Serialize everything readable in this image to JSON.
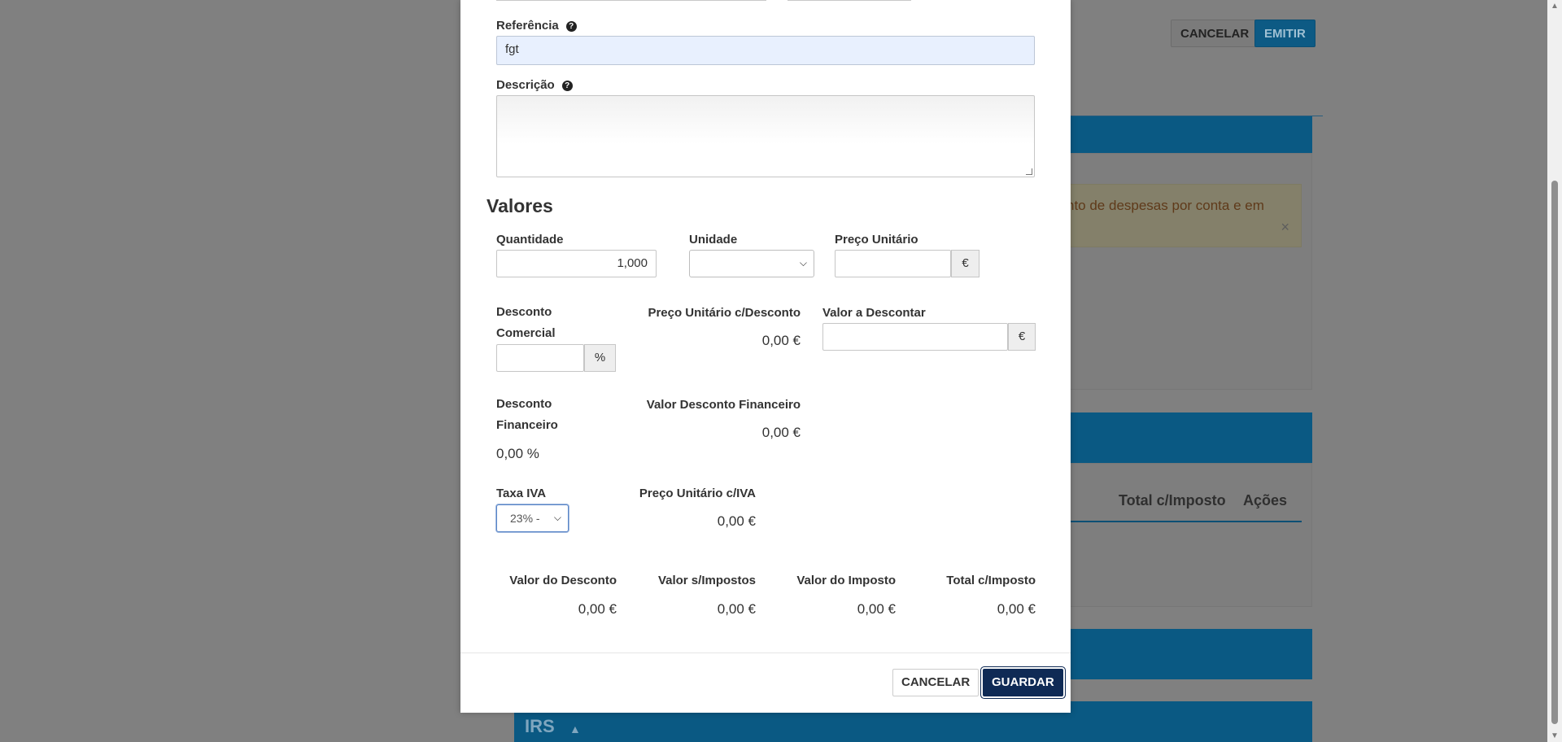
{
  "background": {
    "cancel_label": "CANCELAR",
    "emitir_label": "EMITIR",
    "alert_text": "nto de despesas por conta e em",
    "alert_close": "×",
    "table_headers": [
      "Total c/Imposto",
      "Ações"
    ],
    "irs_label": "IRS",
    "colors": {
      "primary": "#005a87",
      "alert_bg": "#fcf8e3"
    }
  },
  "modal": {
    "referencia": {
      "label": "Referência",
      "value": "fgt"
    },
    "descricao": {
      "label": "Descrição",
      "value": ""
    },
    "section_title": "Valores",
    "quantidade": {
      "label": "Quantidade",
      "value": "1,000"
    },
    "unidade": {
      "label": "Unidade",
      "value": ""
    },
    "preco_unitario": {
      "label": "Preço Unitário",
      "value": "",
      "currency": "€"
    },
    "desconto_comercial": {
      "label": "Desconto Comercial",
      "value": "",
      "unit": "%"
    },
    "preco_unitario_desconto": {
      "label": "Preço Unitário c/Desconto",
      "value": "0,00 €"
    },
    "valor_a_descontar": {
      "label": "Valor a Descontar",
      "value": "",
      "currency": "€"
    },
    "desconto_financeiro": {
      "label": "Desconto Financeiro",
      "value": "0,00 %"
    },
    "valor_desconto_financeiro": {
      "label": "Valor Desconto Financeiro",
      "value": "0,00 €"
    },
    "taxa_iva": {
      "label": "Taxa IVA",
      "value": "23% -"
    },
    "preco_unitario_iva": {
      "label": "Preço Unitário c/IVA",
      "value": "0,00 €"
    },
    "summary": {
      "valor_desconto": {
        "label": "Valor do Desconto",
        "value": "0,00 €"
      },
      "valor_sem_impostos": {
        "label": "Valor s/Impostos",
        "value": "0,00 €"
      },
      "valor_imposto": {
        "label": "Valor do Imposto",
        "value": "0,00 €"
      },
      "total_com_imposto": {
        "label": "Total c/Imposto",
        "value": "0,00 €"
      }
    },
    "cancel_label": "CANCELAR",
    "save_label": "GUARDAR",
    "colors": {
      "save_button": "#0f2a55",
      "ref_input_bg": "#e8f0fe"
    }
  }
}
